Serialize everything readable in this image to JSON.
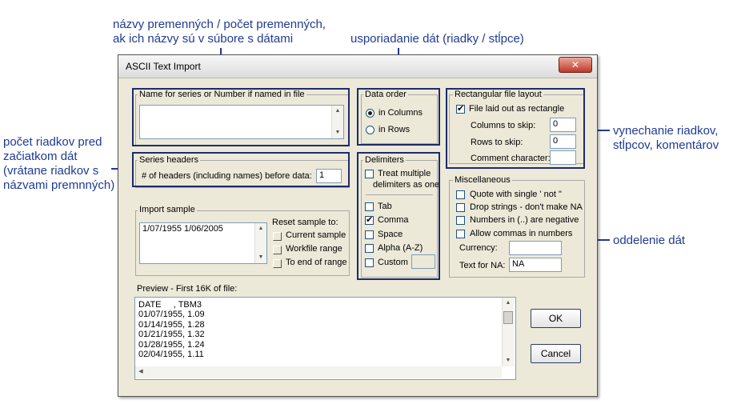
{
  "annotations": {
    "names_line1": "názvy premenných / počet premenných,",
    "names_line2": "ak ich názvy sú v súbore s dátami",
    "order": "usporiadanie dát (riadky / stĺpce)",
    "headers_line1": "počet riadkov pred",
    "headers_line2": "začiatkom dát",
    "headers_line3": "(vrátane riadkov s",
    "headers_line4": "názvami premnných)",
    "skip_line1": "vynechanie riadkov,",
    "skip_line2": "stĺpcov, komentárov",
    "delim": "oddelenie dát"
  },
  "dialog": {
    "title": "ASCII Text Import",
    "close_glyph": "✕"
  },
  "names_group": {
    "label": "Name for series or Number if named in file",
    "value": ""
  },
  "data_order": {
    "label": "Data order",
    "in_columns": "in Columns",
    "in_rows": "in Rows",
    "selected": "in Columns"
  },
  "rect_layout": {
    "label": "Rectangular file layout",
    "laid_out": "File laid out as rectangle",
    "laid_out_checked": true,
    "cols_skip_label": "Columns to skip:",
    "cols_skip_value": "0",
    "rows_skip_label": "Rows to skip:",
    "rows_skip_value": "0",
    "comment_label": "Comment character:",
    "comment_value": ""
  },
  "series_headers": {
    "label": "Series headers",
    "count_label": "# of headers (including names) before data:",
    "count_value": "1"
  },
  "delimiters": {
    "label": "Delimiters",
    "treat_multiple_1": "Treat multiple",
    "treat_multiple_2": "delimiters as one",
    "tab": "Tab",
    "comma": "Comma",
    "space": "Space",
    "alpha": "Alpha (A-Z)",
    "custom": "Custom",
    "custom_value": "",
    "comma_checked": true
  },
  "misc": {
    "label": "Miscellaneous",
    "quote": "Quote with single ' not \"",
    "drop_strings": "Drop strings - don't make NA",
    "negative": "Numbers in (..) are negative",
    "allow_commas": "Allow commas in numbers",
    "currency_label": "Currency:",
    "currency_value": "",
    "na_label": "Text for NA:",
    "na_value": "NA"
  },
  "import_sample": {
    "label": "Import sample",
    "value": "1/07/1955 1/06/2005",
    "reset_label": "Reset sample to:",
    "current": "Current sample",
    "workfile": "Workfile range",
    "end": "To end of range"
  },
  "preview": {
    "label": "Preview -  First 16K of file:",
    "lines": [
      "DATE     , TBM3",
      "01/07/1955, 1.09",
      "01/14/1955, 1.28",
      "01/21/1955, 1.32",
      "01/28/1955, 1.24",
      "02/04/1955, 1.11"
    ]
  },
  "buttons": {
    "ok": "OK",
    "cancel": "Cancel"
  }
}
